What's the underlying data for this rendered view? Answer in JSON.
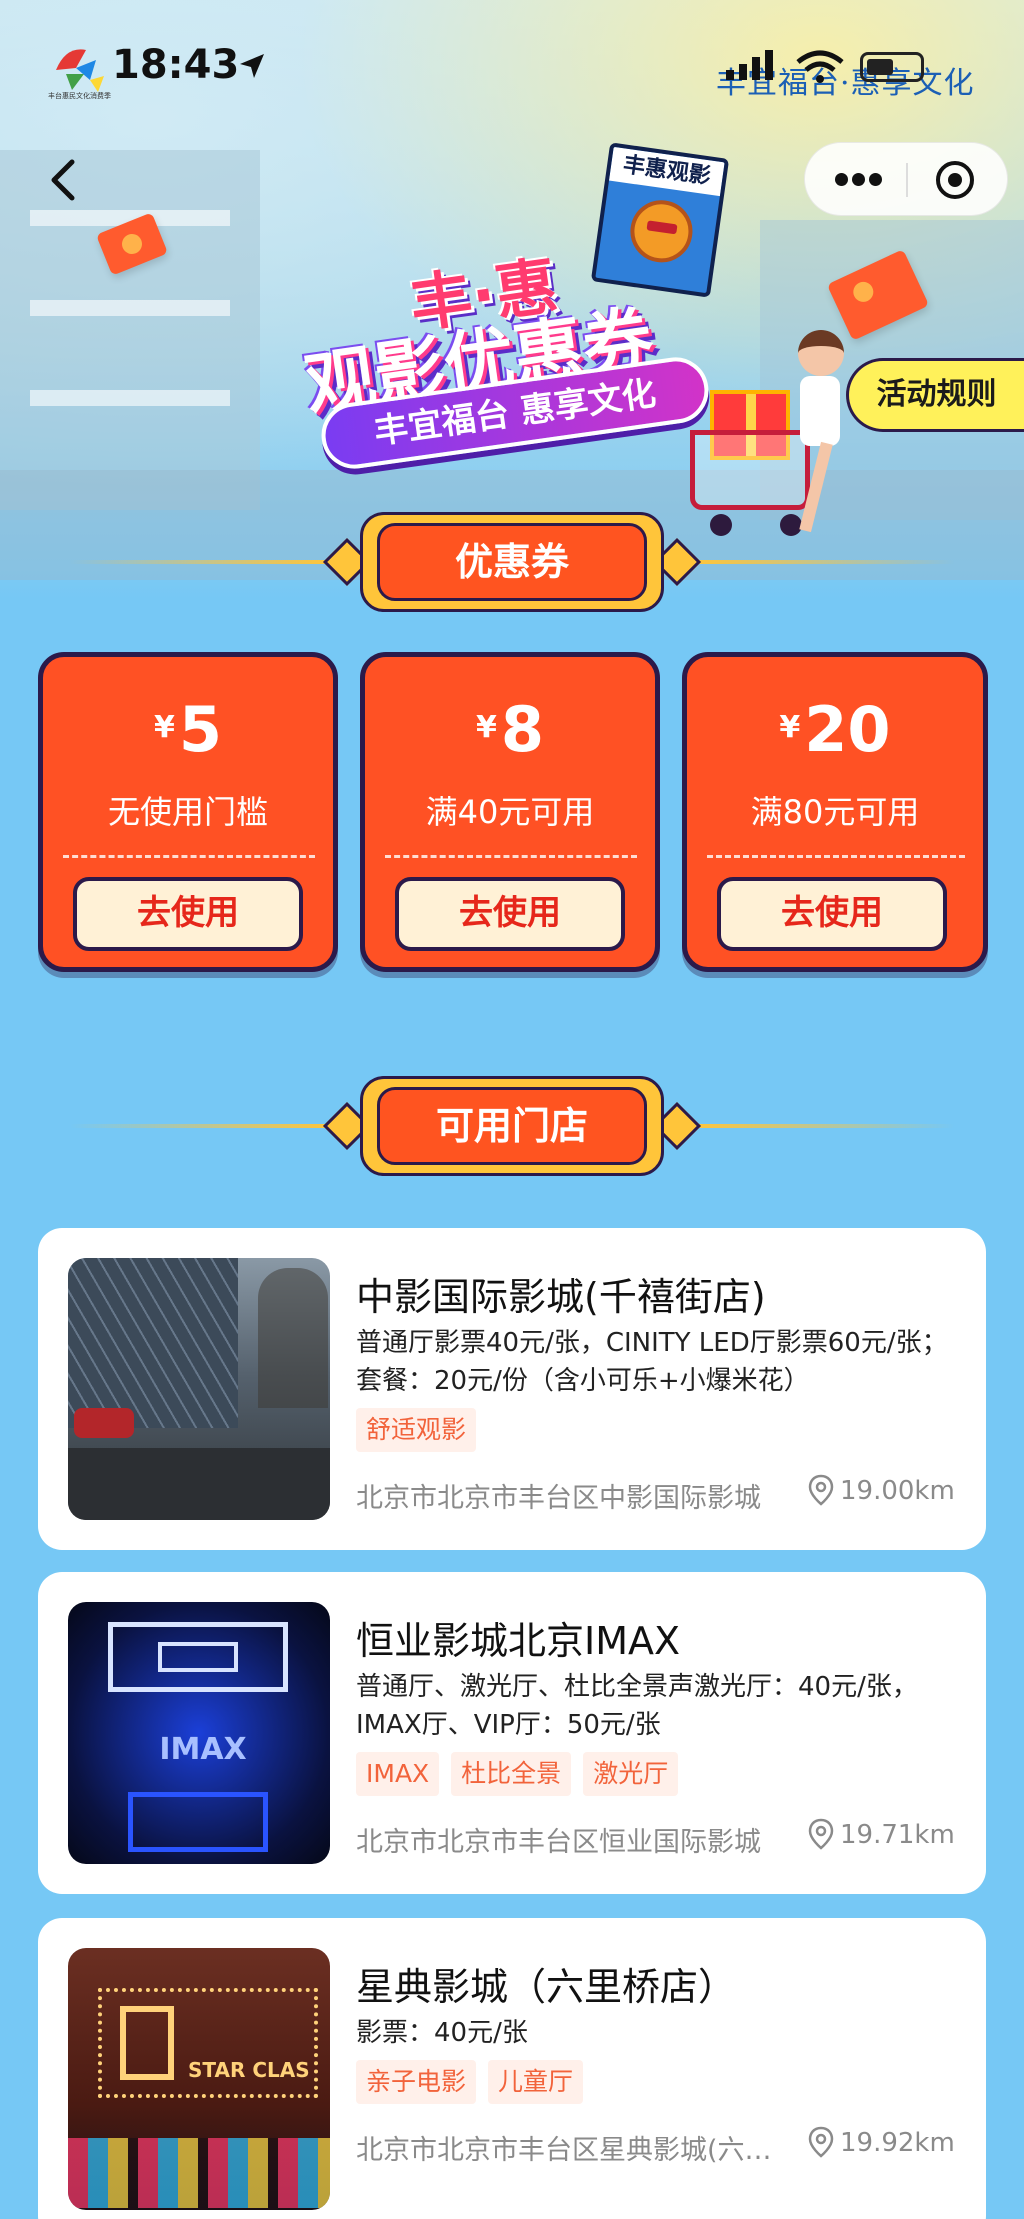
{
  "status_bar": {
    "time": "18:43",
    "brand_text": "丰宜福台·惠享文化",
    "logo_caption": "丰台惠民文化消费季"
  },
  "nav": {
    "back_label": "‹",
    "capsule_more": "more-icon",
    "capsule_close": "target-icon"
  },
  "hero": {
    "title_top": "丰·惠",
    "title_main": "观影优惠券",
    "slogan": "丰宜福台 惠享文化",
    "poster_label": "丰惠观影",
    "rules_button": "活动规则"
  },
  "coupon_section": {
    "title": "优惠券",
    "coupons": [
      {
        "currency": "¥",
        "amount": "5",
        "condition": "无使用门槛",
        "action": "去使用"
      },
      {
        "currency": "¥",
        "amount": "8",
        "condition": "满40元可用",
        "action": "去使用"
      },
      {
        "currency": "¥",
        "amount": "20",
        "condition": "满80元可用",
        "action": "去使用"
      }
    ]
  },
  "store_section": {
    "title": "可用门店",
    "stores": [
      {
        "name": "中影国际影城(千禧街店)",
        "desc": "普通厅影票40元/张，CINITY LED厅影票60元/张；套餐：20元/份（含小可乐+小爆米花）",
        "tags": [
          "舒适观影"
        ],
        "address": "北京市北京市丰台区中影国际影城",
        "distance": "19.00km"
      },
      {
        "name": "恒业影城北京IMAX",
        "desc": "普通厅、激光厅、杜比全景声激光厅：40元/张，IMAX厅、VIP厅：50元/张",
        "tags": [
          "IMAX",
          "杜比全景",
          "激光厅"
        ],
        "address": "北京市北京市丰台区恒业国际影城",
        "distance": "19.71km",
        "image_text": "IMAX"
      },
      {
        "name": "星典影城（六里桥店）",
        "desc": "影票：40元/张",
        "tags": [
          "亲子电影",
          "儿童厅"
        ],
        "address": "北京市北京市丰台区星典影城(六里桥店)",
        "distance": "19.92km",
        "image_text": "STAR CLAS"
      }
    ]
  },
  "colors": {
    "page_bg": "#76c8f5",
    "coupon_red": "#ff5124",
    "tag_text": "#f2633b",
    "outline": "#2b1a4a",
    "gold": "#ffc53a"
  }
}
